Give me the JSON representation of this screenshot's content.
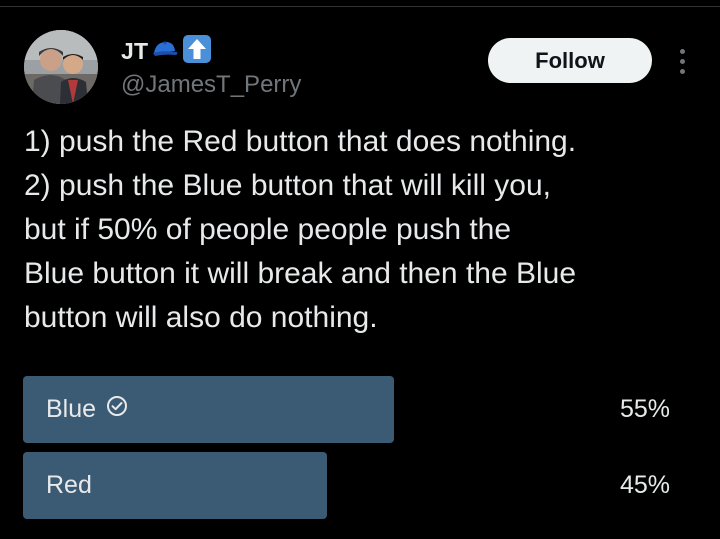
{
  "author": {
    "display_name": "JT",
    "handle": "@JamesT_Perry",
    "name_emojis": [
      "blue-cap-icon",
      "up-arrow-icon"
    ]
  },
  "actions": {
    "follow_label": "Follow"
  },
  "tweet": {
    "lines": [
      "1) push the Red button that does nothing.",
      "2) push the Blue button that will kill you,",
      "but if 50% of people people push the",
      "Blue button it will break and then the Blue",
      "button will also do nothing."
    ]
  },
  "poll": {
    "options": [
      {
        "label": "Blue",
        "percent_text": "55%",
        "percent": 55,
        "selected": true
      },
      {
        "label": "Red",
        "percent_text": "45%",
        "percent": 45,
        "selected": false
      }
    ]
  },
  "colors": {
    "background": "#000000",
    "bar": "#3b5a73",
    "text": "#e7e9ea",
    "muted": "#71767b",
    "follow_bg": "#eff3f4"
  }
}
